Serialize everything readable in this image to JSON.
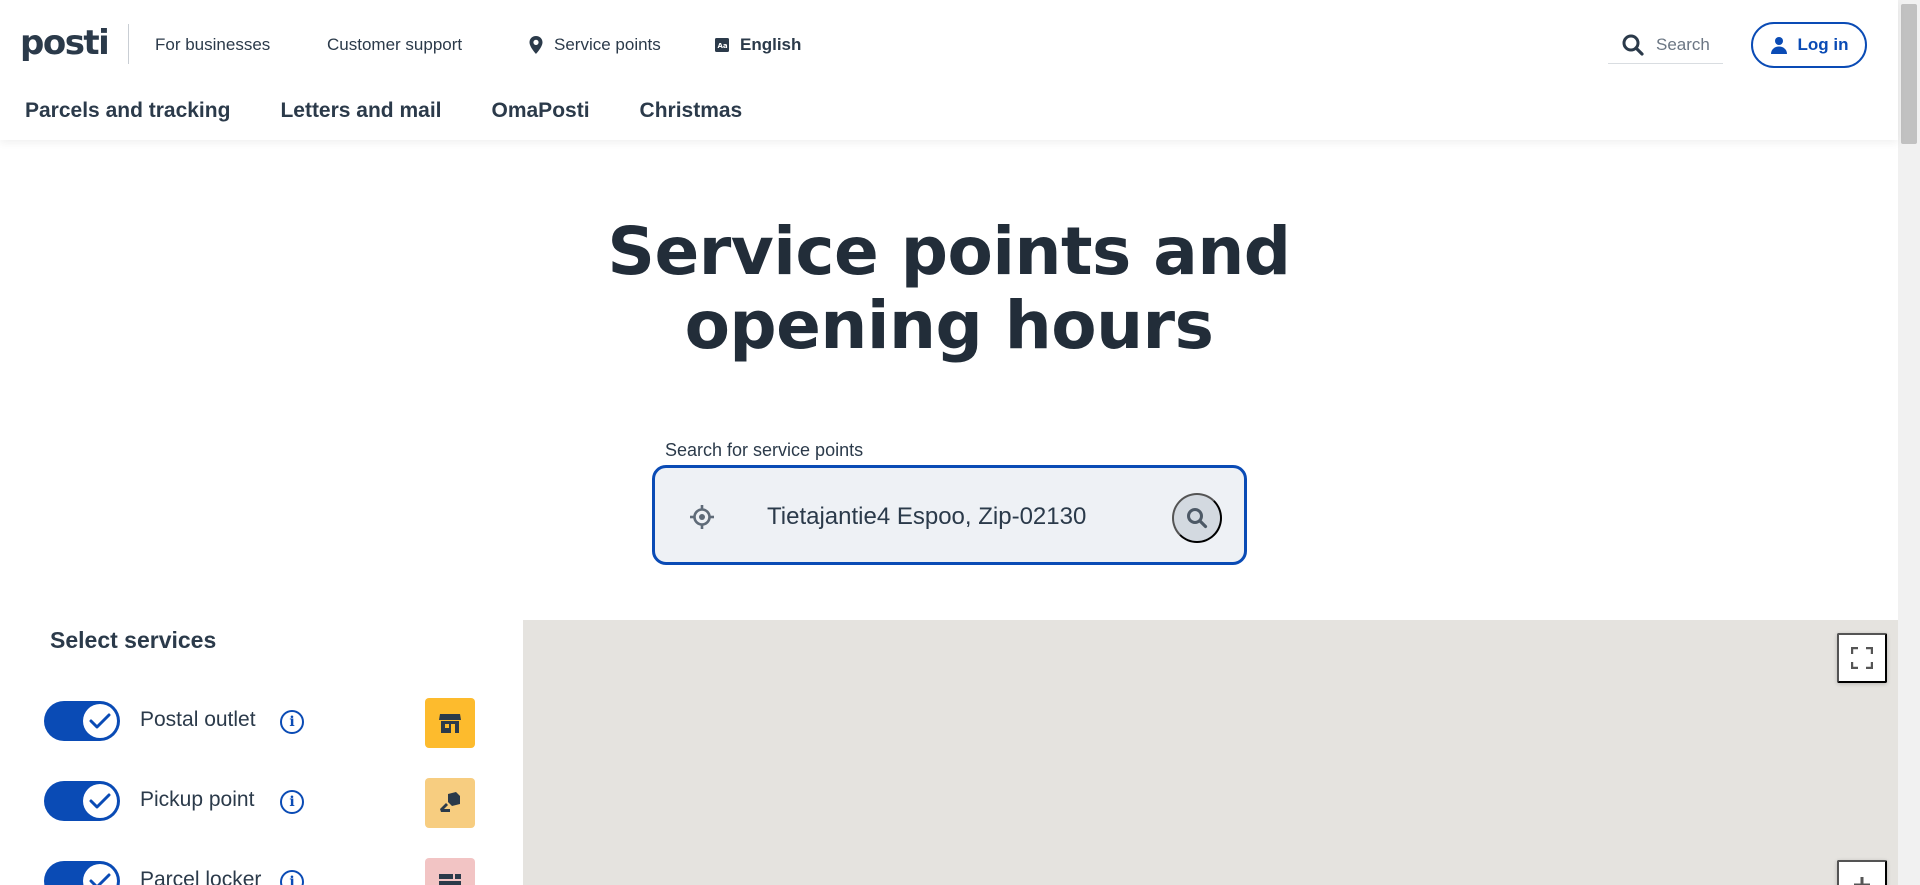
{
  "header": {
    "logo_text": "posti",
    "top_links": {
      "businesses": "For businesses",
      "support": "Customer support",
      "service_points": "Service points",
      "language": "English"
    },
    "search_label": "Search",
    "login_label": "Log in",
    "nav": [
      "Parcels and tracking",
      "Letters and mail",
      "OmaPosti",
      "Christmas"
    ]
  },
  "hero": {
    "title_line1": "Service points and",
    "title_line2": "opening hours"
  },
  "search": {
    "label": "Search for service points",
    "value": "Tietajantie4 Espoo, Zip-02130"
  },
  "services": {
    "title": "Select services",
    "items": [
      {
        "label": "Postal outlet",
        "enabled": true,
        "badge_color": "#fdbb2d",
        "icon": "store-icon"
      },
      {
        "label": "Pickup point",
        "enabled": true,
        "badge_color": "#f7cd80",
        "icon": "parcel-handover-icon"
      },
      {
        "label": "Parcel locker",
        "enabled": true,
        "badge_color": "#f2c4c4",
        "icon": "parcel-locker-icon"
      }
    ]
  },
  "colors": {
    "brand_blue": "#0a4bb5",
    "text_dark": "#222d39",
    "map_bg": "#e5e3df"
  }
}
